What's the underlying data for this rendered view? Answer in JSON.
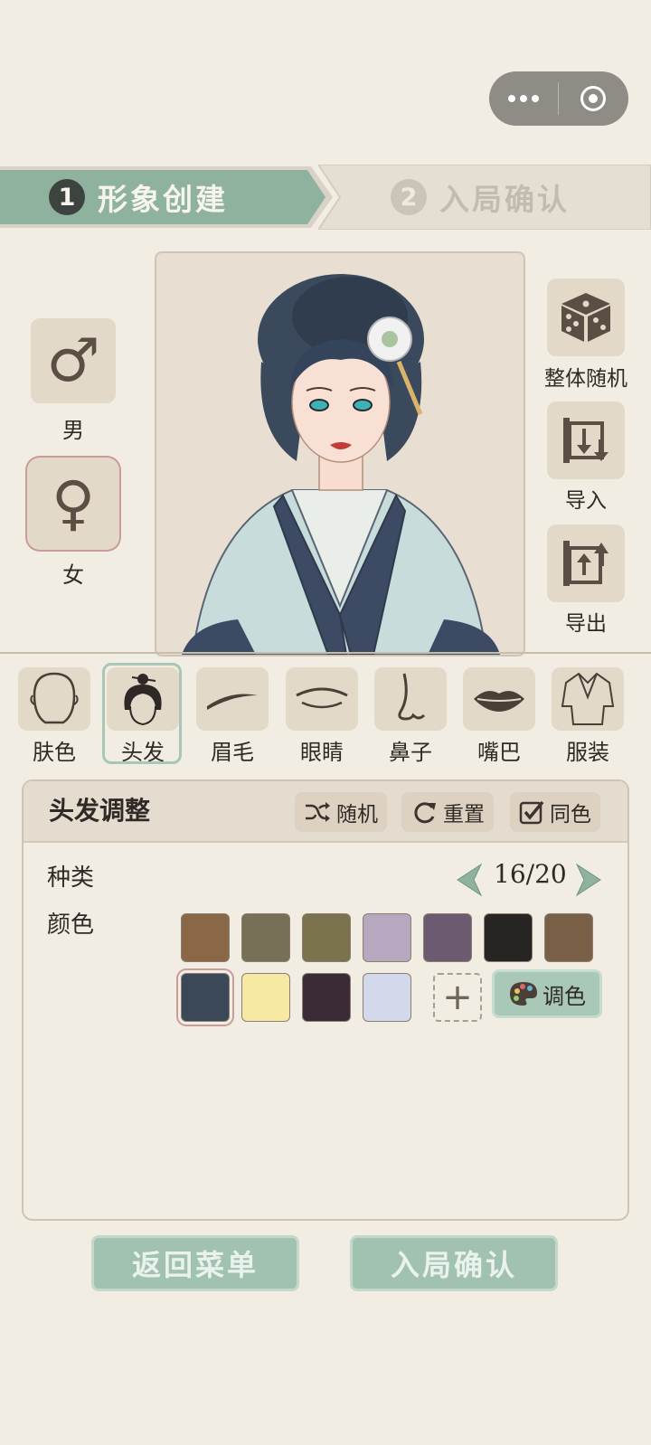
{
  "steps": [
    {
      "num": "1",
      "label": "形象创建"
    },
    {
      "num": "2",
      "label": "入局确认"
    }
  ],
  "gender": {
    "male": {
      "symbol": "♂",
      "label": "男"
    },
    "female": {
      "symbol": "♀",
      "label": "女"
    },
    "selected": "female"
  },
  "side_actions": {
    "random_all": "整体随机",
    "import": "导入",
    "export": "导出"
  },
  "features": [
    {
      "label": "肤色",
      "icon": "face-icon"
    },
    {
      "label": "头发",
      "icon": "hair-icon"
    },
    {
      "label": "眉毛",
      "icon": "eyebrow-icon"
    },
    {
      "label": "眼睛",
      "icon": "eye-icon"
    },
    {
      "label": "鼻子",
      "icon": "nose-icon"
    },
    {
      "label": "嘴巴",
      "icon": "lips-icon"
    },
    {
      "label": "服装",
      "icon": "robe-icon"
    }
  ],
  "selected_feature": "头发",
  "panel": {
    "title": "头发调整",
    "random": "随机",
    "reset": "重置",
    "same_color": "同色",
    "same_color_checked": true,
    "type_label": "种类",
    "type_value": "16/20",
    "color_label": "颜色",
    "palette_button": "调色",
    "add_symbol": "+"
  },
  "colors": [
    "#8a6747",
    "#767056",
    "#7a734e",
    "#b6a8bf",
    "#6c5a70",
    "#262524",
    "#7b6048",
    "#3a4858",
    "#f5e9a4",
    "#3b2b36",
    "#d3d8ea"
  ],
  "selected_color_index": 7,
  "buttons": {
    "back": "返回菜单",
    "confirm": "入局确认"
  },
  "theme": {
    "accent": "#8fb29f",
    "background": "#f1ede3",
    "tile": "#e3d9c9"
  }
}
